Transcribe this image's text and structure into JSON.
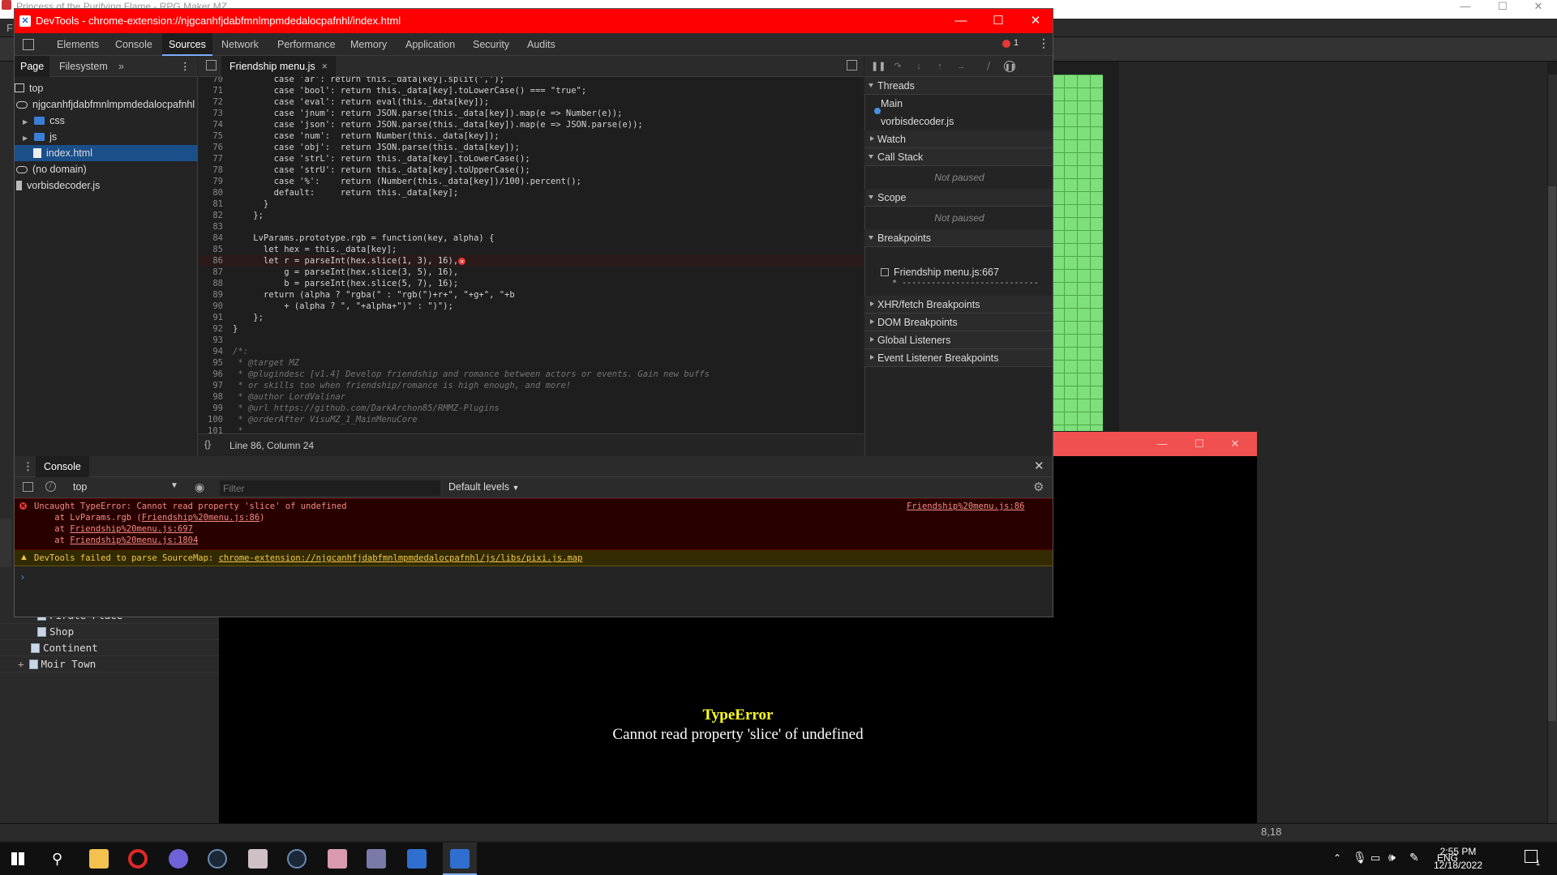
{
  "background_app": {
    "title": "Princess of the Purifying Flame - RPG Maker MZ",
    "menu_first_letter": "F",
    "map_tree": [
      "Pirate Place",
      "Shop",
      "Continent",
      "Moir Town"
    ],
    "status_coords": "8,18"
  },
  "game_window": {
    "error_title": "TypeError",
    "error_message": "Cannot read property 'slice' of undefined"
  },
  "devtools": {
    "title": "DevTools - chrome-extension://njgcanhfjdabfmnlmpmdedalocpafnhl/index.html",
    "tabs": [
      "Elements",
      "Console",
      "Sources",
      "Network",
      "Performance",
      "Memory",
      "Application",
      "Security",
      "Audits"
    ],
    "active_tab": "Sources",
    "error_count": "1",
    "navigator": {
      "tabs": [
        "Page",
        "Filesystem"
      ],
      "tree": [
        {
          "label": "top",
          "icon": "frame-icon"
        },
        {
          "label": "njgcanhfjdabfmnlmpmdedalocpafnhl",
          "icon": "cloud-icon"
        },
        {
          "label": "css",
          "icon": "folder-icon"
        },
        {
          "label": "js",
          "icon": "folder-icon"
        },
        {
          "label": "index.html",
          "icon": "file-icon",
          "selected": true
        },
        {
          "label": "(no domain)",
          "icon": "cloud-icon"
        },
        {
          "label": "vorbisdecoder.js",
          "icon": "gear-file-icon"
        }
      ]
    },
    "editor": {
      "open_file": "Friendship menu.js",
      "status": "Line 86, Column 24",
      "lines": [
        {
          "n": "70",
          "code": "        case 'ar': return this._data[key].split(',');"
        },
        {
          "n": "71",
          "code": "        case 'bool': return this._data[key].toLowerCase() === \"true\";"
        },
        {
          "n": "72",
          "code": "        case 'eval': return eval(this._data[key]);"
        },
        {
          "n": "73",
          "code": "        case 'jnum': return JSON.parse(this._data[key]).map(e => Number(e));"
        },
        {
          "n": "74",
          "code": "        case 'json': return JSON.parse(this._data[key]).map(e => JSON.parse(e));"
        },
        {
          "n": "75",
          "code": "        case 'num':  return Number(this._data[key]);"
        },
        {
          "n": "76",
          "code": "        case 'obj':  return JSON.parse(this._data[key]);"
        },
        {
          "n": "77",
          "code": "        case 'strL': return this._data[key].toLowerCase();"
        },
        {
          "n": "78",
          "code": "        case 'strU': return this._data[key].toUpperCase();"
        },
        {
          "n": "79",
          "code": "        case '%':    return (Number(this._data[key])/100).percent();"
        },
        {
          "n": "80",
          "code": "        default:     return this._data[key];"
        },
        {
          "n": "81",
          "code": "      }"
        },
        {
          "n": "82",
          "code": "    };"
        },
        {
          "n": "83",
          "code": ""
        },
        {
          "n": "84",
          "code": "    LvParams.prototype.rgb = function(key, alpha) {"
        },
        {
          "n": "85",
          "code": "      let hex = this._data[key];"
        },
        {
          "n": "86",
          "code": "      let r = parseInt(hex.slice(1, 3), 16),",
          "error": true
        },
        {
          "n": "87",
          "code": "          g = parseInt(hex.slice(3, 5), 16),"
        },
        {
          "n": "88",
          "code": "          b = parseInt(hex.slice(5, 7), 16);"
        },
        {
          "n": "89",
          "code": "      return (alpha ? \"rgba(\" : \"rgb(\")+r+\", \"+g+\", \"+b"
        },
        {
          "n": "90",
          "code": "          + (alpha ? \", \"+alpha+\")\" : \")\");"
        },
        {
          "n": "91",
          "code": "    };"
        },
        {
          "n": "92",
          "code": "}"
        },
        {
          "n": "93",
          "code": ""
        },
        {
          "n": "94",
          "code": "/*:",
          "comment": true
        },
        {
          "n": "95",
          "code": " * @target MZ",
          "comment": true
        },
        {
          "n": "96",
          "code": " * @plugindesc [v1.4] Develop friendship and romance between actors or events. Gain new buffs",
          "comment": true
        },
        {
          "n": "97",
          "code": " * or skills too when friendship/romance is high enough, and more!",
          "comment": true
        },
        {
          "n": "98",
          "code": " * @author LordValinar",
          "comment": true
        },
        {
          "n": "99",
          "code": " * @url https://github.com/DarkArchon85/RMMZ-Plugins",
          "comment": true
        },
        {
          "n": "100",
          "code": " * @orderAfter VisuMZ_1_MainMenuCore",
          "comment": true
        },
        {
          "n": "101",
          "code": " *",
          "comment": true
        }
      ]
    },
    "debugger": {
      "threads_label": "Threads",
      "threads": [
        "Main",
        "vorbisdecoder.js"
      ],
      "watch_label": "Watch",
      "call_stack_label": "Call Stack",
      "not_paused": "Not paused",
      "scope_label": "Scope",
      "breakpoints_label": "Breakpoints",
      "breakpoint_file": "Friendship menu.js:667",
      "breakpoint_code": "* ----------------------------",
      "xhr_label": "XHR/fetch Breakpoints",
      "dom_label": "DOM Breakpoints",
      "global_label": "Global Listeners",
      "event_label": "Event Listener Breakpoints"
    },
    "console": {
      "tab_label": "Console",
      "context": "top",
      "filter_placeholder": "Filter",
      "levels": "Default levels",
      "error_line": "Uncaught TypeError: Cannot read property 'slice' of undefined",
      "error_source": "Friendship%20menu.js:86",
      "stack": [
        {
          "prefix": "    at LvParams.rgb (",
          "link": "Friendship%20menu.js:86",
          "suffix": ")"
        },
        {
          "prefix": "    at ",
          "link": "Friendship%20menu.js:697",
          "suffix": ""
        },
        {
          "prefix": "    at ",
          "link": "Friendship%20menu.js:1804",
          "suffix": ""
        }
      ],
      "warning_prefix": "DevTools failed to parse SourceMap: ",
      "warning_link": "chrome-extension://njgcanhfjdabfmnlmpmdedalocpafnhl/js/libs/pixi.js.map"
    }
  },
  "taskbar": {
    "apps": [
      "windows-start-icon",
      "search-icon",
      "file-explorer-icon",
      "opera-icon",
      "discord-icon",
      "steam-icon",
      "rpg-maker-icon",
      "steam-icon",
      "anime-app-icon",
      "game-icon",
      "rpg-maker-mz-icon",
      "devtools-icon"
    ],
    "language": "ENG",
    "time": "2:55 PM",
    "date": "12/18/2022",
    "notification_count": "1"
  },
  "colors": {
    "devtools_titlebar": "#ff0000",
    "error_background": "#290000",
    "warning_background": "#332b00",
    "accent": "#7cacf8",
    "game_error_title": "#ffff20"
  }
}
